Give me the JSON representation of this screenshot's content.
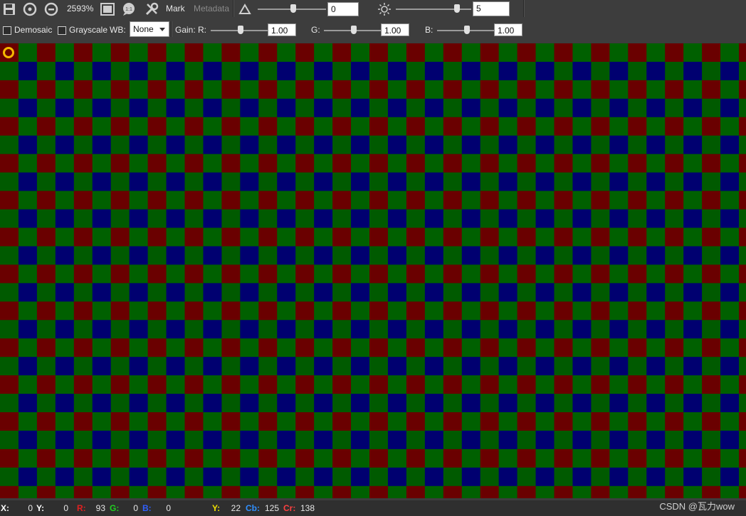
{
  "toolbar": {
    "zoom": "2593%",
    "mark_label": "Mark",
    "metadata_label": "Metadata",
    "contrast_value": "0",
    "brightness_value": "5",
    "icons": [
      "save-icon",
      "zoom-in-icon",
      "zoom-out-icon",
      "fit-window-icon",
      "one-to-one-icon",
      "tools-icon",
      "contrast-icon",
      "brightness-icon"
    ]
  },
  "options": {
    "demosaic_label": "Demosaic",
    "grayscale_label": "Grayscale",
    "wb_label": "WB:",
    "wb_value": "None",
    "gain_label": "Gain:",
    "r_label": "R:",
    "r_value": "1.00",
    "g_label": "G:",
    "g_value": "1.00",
    "b_label": "B:",
    "b_value": "1.00"
  },
  "status": {
    "x_label": "X:",
    "x_value": "0",
    "y_label": "Y:",
    "y_value": "0",
    "r_label": "R:",
    "r_value": "93",
    "g_label": "G:",
    "g_value": "0",
    "b_label": "B:",
    "b_value": "0",
    "luma_label": "Y:",
    "luma_value": "22",
    "cb_label": "Cb:",
    "cb_value": "125",
    "cr_label": "Cr:",
    "cr_value": "138"
  },
  "watermark": "CSDN @瓦力wow",
  "colors": {
    "bayer_red": "#6a0000",
    "bayer_green": "#006000",
    "bayer_green_alt": "#005a00",
    "bayer_blue": "#000070",
    "cursor": "#f5b800",
    "status_r": "#e02020",
    "status_g": "#20d020",
    "status_b": "#3060ff",
    "status_y": "#f0e000",
    "status_cb": "#3090ff",
    "status_cr": "#ff4040"
  }
}
